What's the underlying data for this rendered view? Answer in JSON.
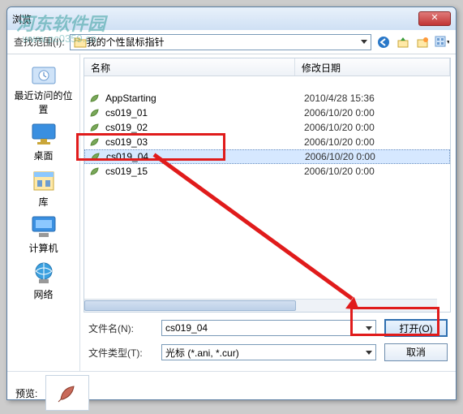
{
  "window": {
    "title": "浏览"
  },
  "toolbar": {
    "lookin_label": "查找范围(I):",
    "lookin_value": "我的个性鼠标指针"
  },
  "sidebar": {
    "items": [
      {
        "label": "最近访问的位置"
      },
      {
        "label": "桌面"
      },
      {
        "label": "库"
      },
      {
        "label": "计算机"
      },
      {
        "label": "网络"
      }
    ]
  },
  "list": {
    "headers": {
      "name": "名称",
      "date": "修改日期"
    },
    "rows": [
      {
        "name": "AppStarting",
        "date": "2010/4/28 15:36"
      },
      {
        "name": "cs019_01",
        "date": "2006/10/20 0:00"
      },
      {
        "name": "cs019_02",
        "date": "2006/10/20 0:00"
      },
      {
        "name": "cs019_03",
        "date": "2006/10/20 0:00"
      },
      {
        "name": "cs019_04",
        "date": "2006/10/20 0:00",
        "selected": true
      },
      {
        "name": "cs019_15",
        "date": "2006/10/20 0:00"
      }
    ]
  },
  "fields": {
    "filename_label": "文件名(N):",
    "filename_value": "cs019_04",
    "filetype_label": "文件类型(T):",
    "filetype_value": "光标 (*.ani, *.cur)",
    "open_label": "打开(O)",
    "cancel_label": "取消"
  },
  "preview": {
    "label": "预览:"
  },
  "watermark": {
    "line1": "河东软件园",
    "line2": "www.pc0359.cn"
  }
}
